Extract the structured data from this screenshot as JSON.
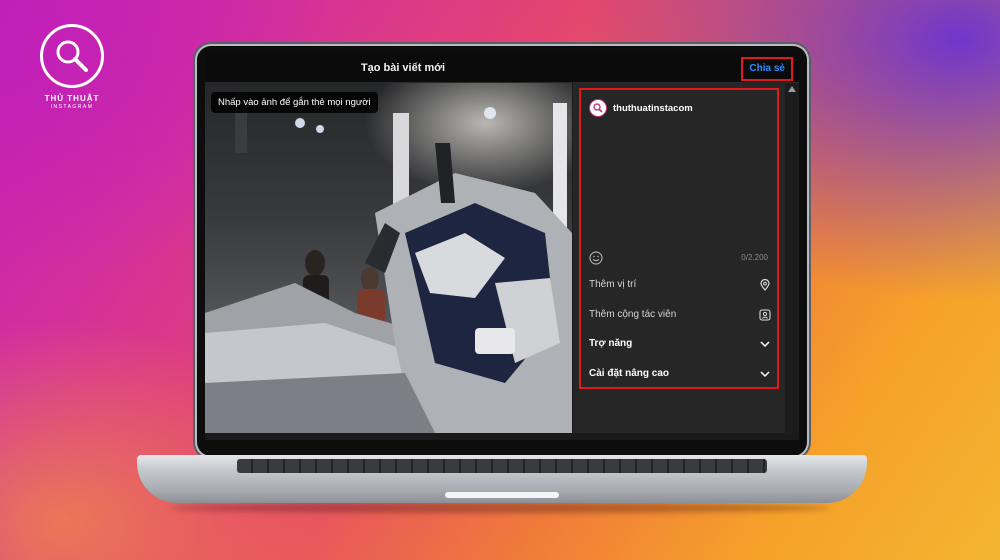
{
  "logo": {
    "line1": "THỦ THUẬT",
    "line2": "INSTAGRAM"
  },
  "window": {
    "title": "Tạo bài viết mới",
    "share_label": "Chia sẻ"
  },
  "photo": {
    "tag_hint": "Nhấp vào ảnh để gắn thẻ mọi người"
  },
  "sidebar": {
    "username": "thuthuatinstacom",
    "char_count": "0/2.200",
    "items": [
      {
        "label": "Thêm vị trí",
        "icon": "location-pin-icon"
      },
      {
        "label": "Thêm cộng tác viên",
        "icon": "add-person-icon"
      },
      {
        "label": "Trợ năng",
        "icon": "chevron-down-icon"
      },
      {
        "label": "Cài đặt nâng cao",
        "icon": "chevron-down-icon"
      }
    ]
  },
  "colors": {
    "highlight": "#e01a1a",
    "link": "#2d8cff",
    "panel": "#262626"
  }
}
